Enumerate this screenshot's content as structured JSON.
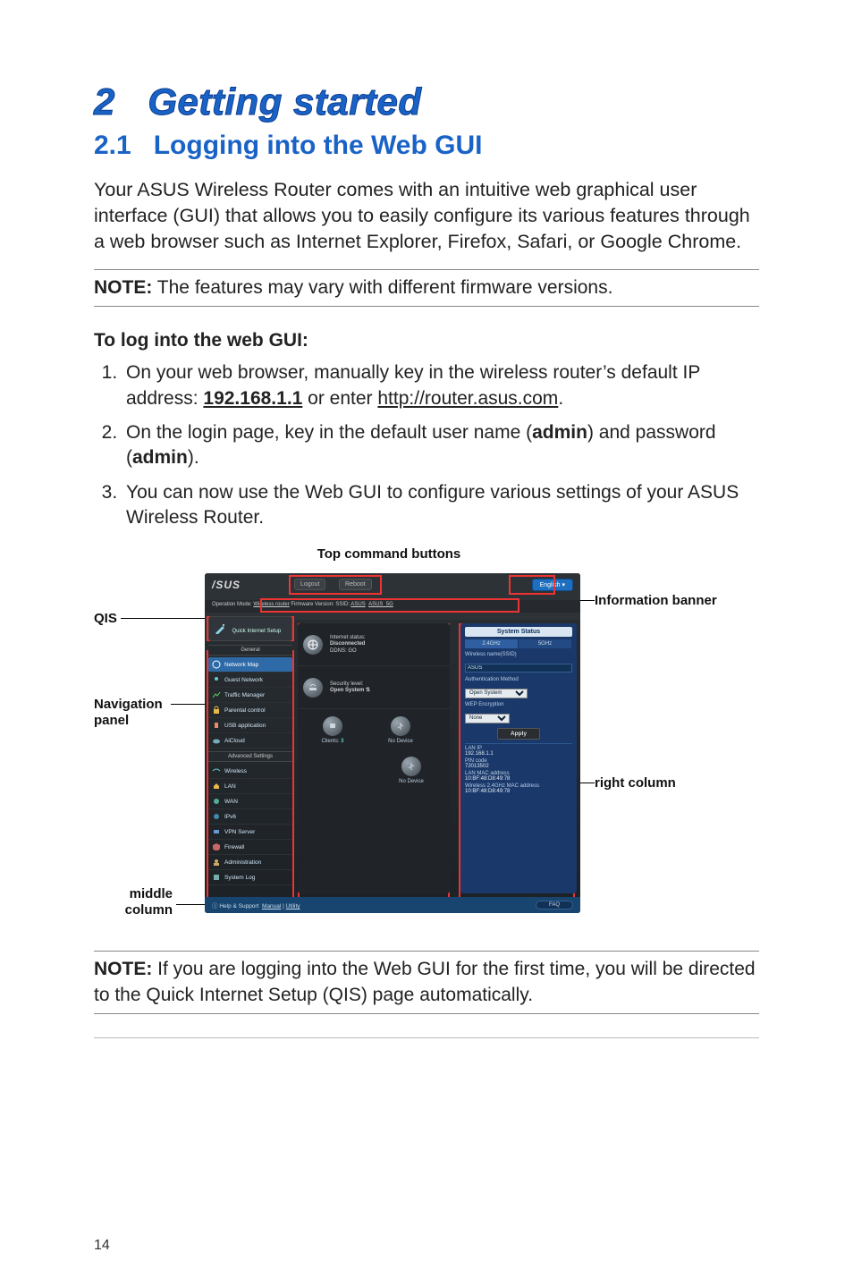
{
  "chapter": {
    "number_label": "2",
    "title": "Getting started"
  },
  "section": {
    "number": "2.1",
    "title": "Logging into the Web GUI"
  },
  "paragraph_intro": "Your ASUS Wireless Router comes with an intuitive web graphical user interface (GUI) that allows you to easily configure its various features through a web browser such as Internet Explorer, Firefox, Safari, or Google Chrome.",
  "note1": {
    "label": "NOTE:",
    "text": "The features may vary with different firmware versions."
  },
  "subheading": "To log into the web GUI:",
  "steps": {
    "s1_a": "On your web browser, manually key in the wireless router’s default IP address: ",
    "s1_ip": "192.168.1.1",
    "s1_b": " or enter ",
    "s1_url": "http://router.asus.com",
    "s1_c": ".",
    "s2_a": "On the login page, key in the default user name (",
    "s2_user": "admin",
    "s2_b": ") and password (",
    "s2_pass": "admin",
    "s2_c": ").",
    "s3": "You can now use the Web GUI to configure various settings of your ASUS Wireless Router."
  },
  "callouts": {
    "top_cmd": "Top command buttons",
    "qis": "QIS",
    "info_banner": "Information banner",
    "nav_panel_a": "Navigation",
    "nav_panel_b": "panel",
    "right_col": "right column",
    "middle_a": "middle",
    "middle_b": "column"
  },
  "gui": {
    "logo": "/SUS",
    "logout": "Logout",
    "reboot": "Reboot",
    "language": "English",
    "info_bar_a": "Operation Mode: ",
    "info_bar_mode": "Wireless router",
    "info_bar_b": "  Firmware Version:     SSID: ",
    "info_bar_ssid1": "ASUS",
    "info_bar_ssid2": "ASUS_5G",
    "qis_label": "Quick Internet Setup",
    "general_label": "General",
    "nav": [
      "Network Map",
      "Guest Network",
      "Traffic Manager",
      "Parental control",
      "USB application",
      "AiCloud"
    ],
    "adv_label": "Advanced Settings",
    "adv": [
      "Wireless",
      "LAN",
      "WAN",
      "IPv6",
      "VPN Server",
      "Firewall",
      "Administration",
      "System Log"
    ],
    "mid": {
      "status_a": "Internet status:",
      "status_b": "Disconnected",
      "ddns": "DDNS: GO",
      "sec_a": "Security level:",
      "sec_b": "Open System",
      "clients_label": "Clients:",
      "clients_value": "3",
      "no_device": "No Device"
    },
    "right": {
      "title": "System Status",
      "tab24": "2.4GHz",
      "tab5": "5GHz",
      "ssid_label": "Wireless name(SSID)",
      "ssid_value": "ASUS",
      "auth_label": "Authentication Method",
      "auth_value": "Open System",
      "wep_label": "WEP Encryption",
      "wep_value": "None",
      "apply": "Apply",
      "lan_ip_k": "LAN IP",
      "lan_ip_v": "192.168.1.1",
      "pin_k": "PIN code",
      "pin_v": "72013502",
      "lan_mac_k": "LAN MAC address",
      "lan_mac_v": "10:BF:48:D8:49:78",
      "w24_mac_k": "Wireless 2.4GHz MAC address",
      "w24_mac_v": "10:BF:48:D8:49:78"
    },
    "footer": {
      "help_label": "Help & Support",
      "manual": "Manual",
      "utility": "Utility",
      "faq": "FAQ"
    }
  },
  "note2": {
    "label": "NOTE:",
    "text": "If you are logging into the Web GUI for the first time, you will be directed to the Quick Internet Setup (QIS) page automatically."
  },
  "page_number": "14"
}
